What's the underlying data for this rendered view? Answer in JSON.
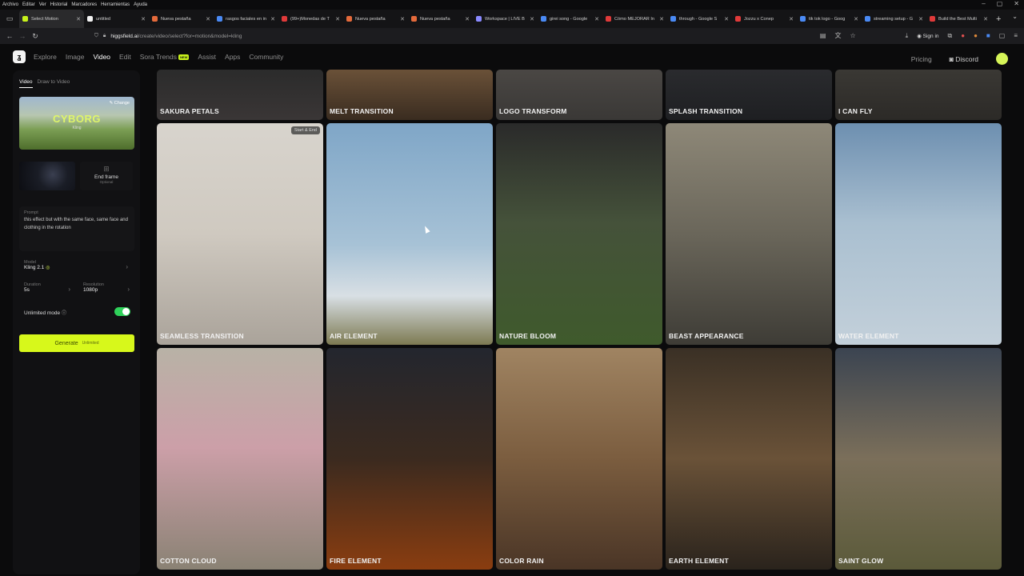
{
  "os_menu": [
    "Archivo",
    "Editar",
    "Ver",
    "Historial",
    "Marcadores",
    "Herramientas",
    "Ayuda"
  ],
  "tabs": [
    {
      "label": "Select Motion",
      "color": "#c8f21b",
      "active": true
    },
    {
      "label": "untitled",
      "color": "#f2f2f2"
    },
    {
      "label": "Nueva pestaña",
      "color": "#e46a3b"
    },
    {
      "label": "rasgos faciales en in",
      "color": "#4a8af4"
    },
    {
      "label": "(99+)Monedas de T",
      "color": "#e03a3a"
    },
    {
      "label": "Nueva pestaña",
      "color": "#e46a3b"
    },
    {
      "label": "Nueva pestaña",
      "color": "#e46a3b"
    },
    {
      "label": "Workspace | LIVE B",
      "color": "#8a8aff"
    },
    {
      "label": "girei song - Google",
      "color": "#4a8af4"
    },
    {
      "label": "Cómo MEJORAR In",
      "color": "#e03a3a"
    },
    {
      "label": "through - Google S",
      "color": "#4a8af4"
    },
    {
      "label": "Jozzu x Conep",
      "color": "#e03a3a"
    },
    {
      "label": "tik tok logo - Goog",
      "color": "#4a8af4"
    },
    {
      "label": "streaming setup - G",
      "color": "#4a8af4"
    },
    {
      "label": "Build the Best Multi",
      "color": "#e03a3a"
    }
  ],
  "url": {
    "host": "higgsfield.ai",
    "path": "/create/video/select?for=motion&model=kling"
  },
  "browser_right": {
    "signin": "Sign in"
  },
  "nav": {
    "items": [
      "Explore",
      "Image",
      "Video",
      "Edit",
      "Sora Trends",
      "Assist",
      "Apps",
      "Community"
    ],
    "active": "Video",
    "new_badge": "NEW",
    "pricing": "Pricing",
    "discord": "Discord"
  },
  "panel": {
    "tab_video": "Video",
    "tab_draw": "Draw to Video",
    "hero_title": "CYBORG",
    "hero_sub": "Kling",
    "change": "Change",
    "end_frame": "End frame",
    "optional": "Optional",
    "prompt_label": "Prompt",
    "prompt_text": "this effect but with the same face, same face and clothing in the rotation",
    "model_label": "Model",
    "model_value": "Kling 2.1",
    "duration_label": "Duration",
    "duration_value": "5s",
    "resolution_label": "Resolution",
    "resolution_value": "1080p",
    "unlimited_label": "Unlimited mode",
    "unlimited_on": true,
    "generate": "Generate",
    "generate_sub": "Unlimited"
  },
  "cards": [
    {
      "label": "SAKURA PETALS",
      "bg": "linear-gradient(180deg,#2b2b2b,#3a3636)"
    },
    {
      "label": "MELT TRANSITION",
      "bg": "linear-gradient(180deg,#6a5138,#3a2c20)"
    },
    {
      "label": "LOGO TRANSFORM",
      "bg": "linear-gradient(180deg,#4a4744,#3a3836)"
    },
    {
      "label": "SPLASH TRANSITION",
      "bg": "linear-gradient(180deg,#2a2b2e,#1e1f22)"
    },
    {
      "label": "I CAN FLY",
      "bg": "linear-gradient(180deg,#3a3834,#2c2a27)"
    },
    {
      "label": "SEAMLESS TRANSITION",
      "bg": "linear-gradient(180deg,#d8d4cd 0%,#cfc9c0 50%,#aaa39a 100%)",
      "badge": "Start & End"
    },
    {
      "label": "AIR ELEMENT",
      "bg": "linear-gradient(180deg,#7fa6c7 0%,#a7c2d6 55%,#d8dfe4 78%,#7d7a52 100%)"
    },
    {
      "label": "NATURE BLOOM",
      "bg": "linear-gradient(180deg,#2a2a2a 0%,#45523a 45%,#3f5a2c 100%)"
    },
    {
      "label": "BEAST APPEARANCE",
      "bg": "linear-gradient(180deg,#8e8878 0%,#6a665a 50%,#3e3c36 100%)"
    },
    {
      "label": "WATER ELEMENT",
      "bg": "linear-gradient(180deg,#6d8fb0 0%,#a9bfd0 45%,#c3d0da 100%)"
    },
    {
      "label": "COTTON CLOUD",
      "bg": "linear-gradient(180deg,#b8b2a6 0%,#cc9fa8 45%,#8a8274 100%)"
    },
    {
      "label": "FIRE ELEMENT",
      "bg": "linear-gradient(180deg,#23262e 0%,#3b2a1f 50%,#8a3d10 100%)"
    },
    {
      "label": "COLOR RAIN",
      "bg": "linear-gradient(180deg,#a08462 0%,#7b5d3f 50%,#4a3526 100%)"
    },
    {
      "label": "EARTH ELEMENT",
      "bg": "linear-gradient(180deg,#3a3025 0%,#6a5238 50%,#2a231c 100%)"
    },
    {
      "label": "SAINT GLOW",
      "bg": "linear-gradient(180deg,#3b4451 0%,#7b6f5a 50%,#5b5a3a 100%)"
    }
  ]
}
